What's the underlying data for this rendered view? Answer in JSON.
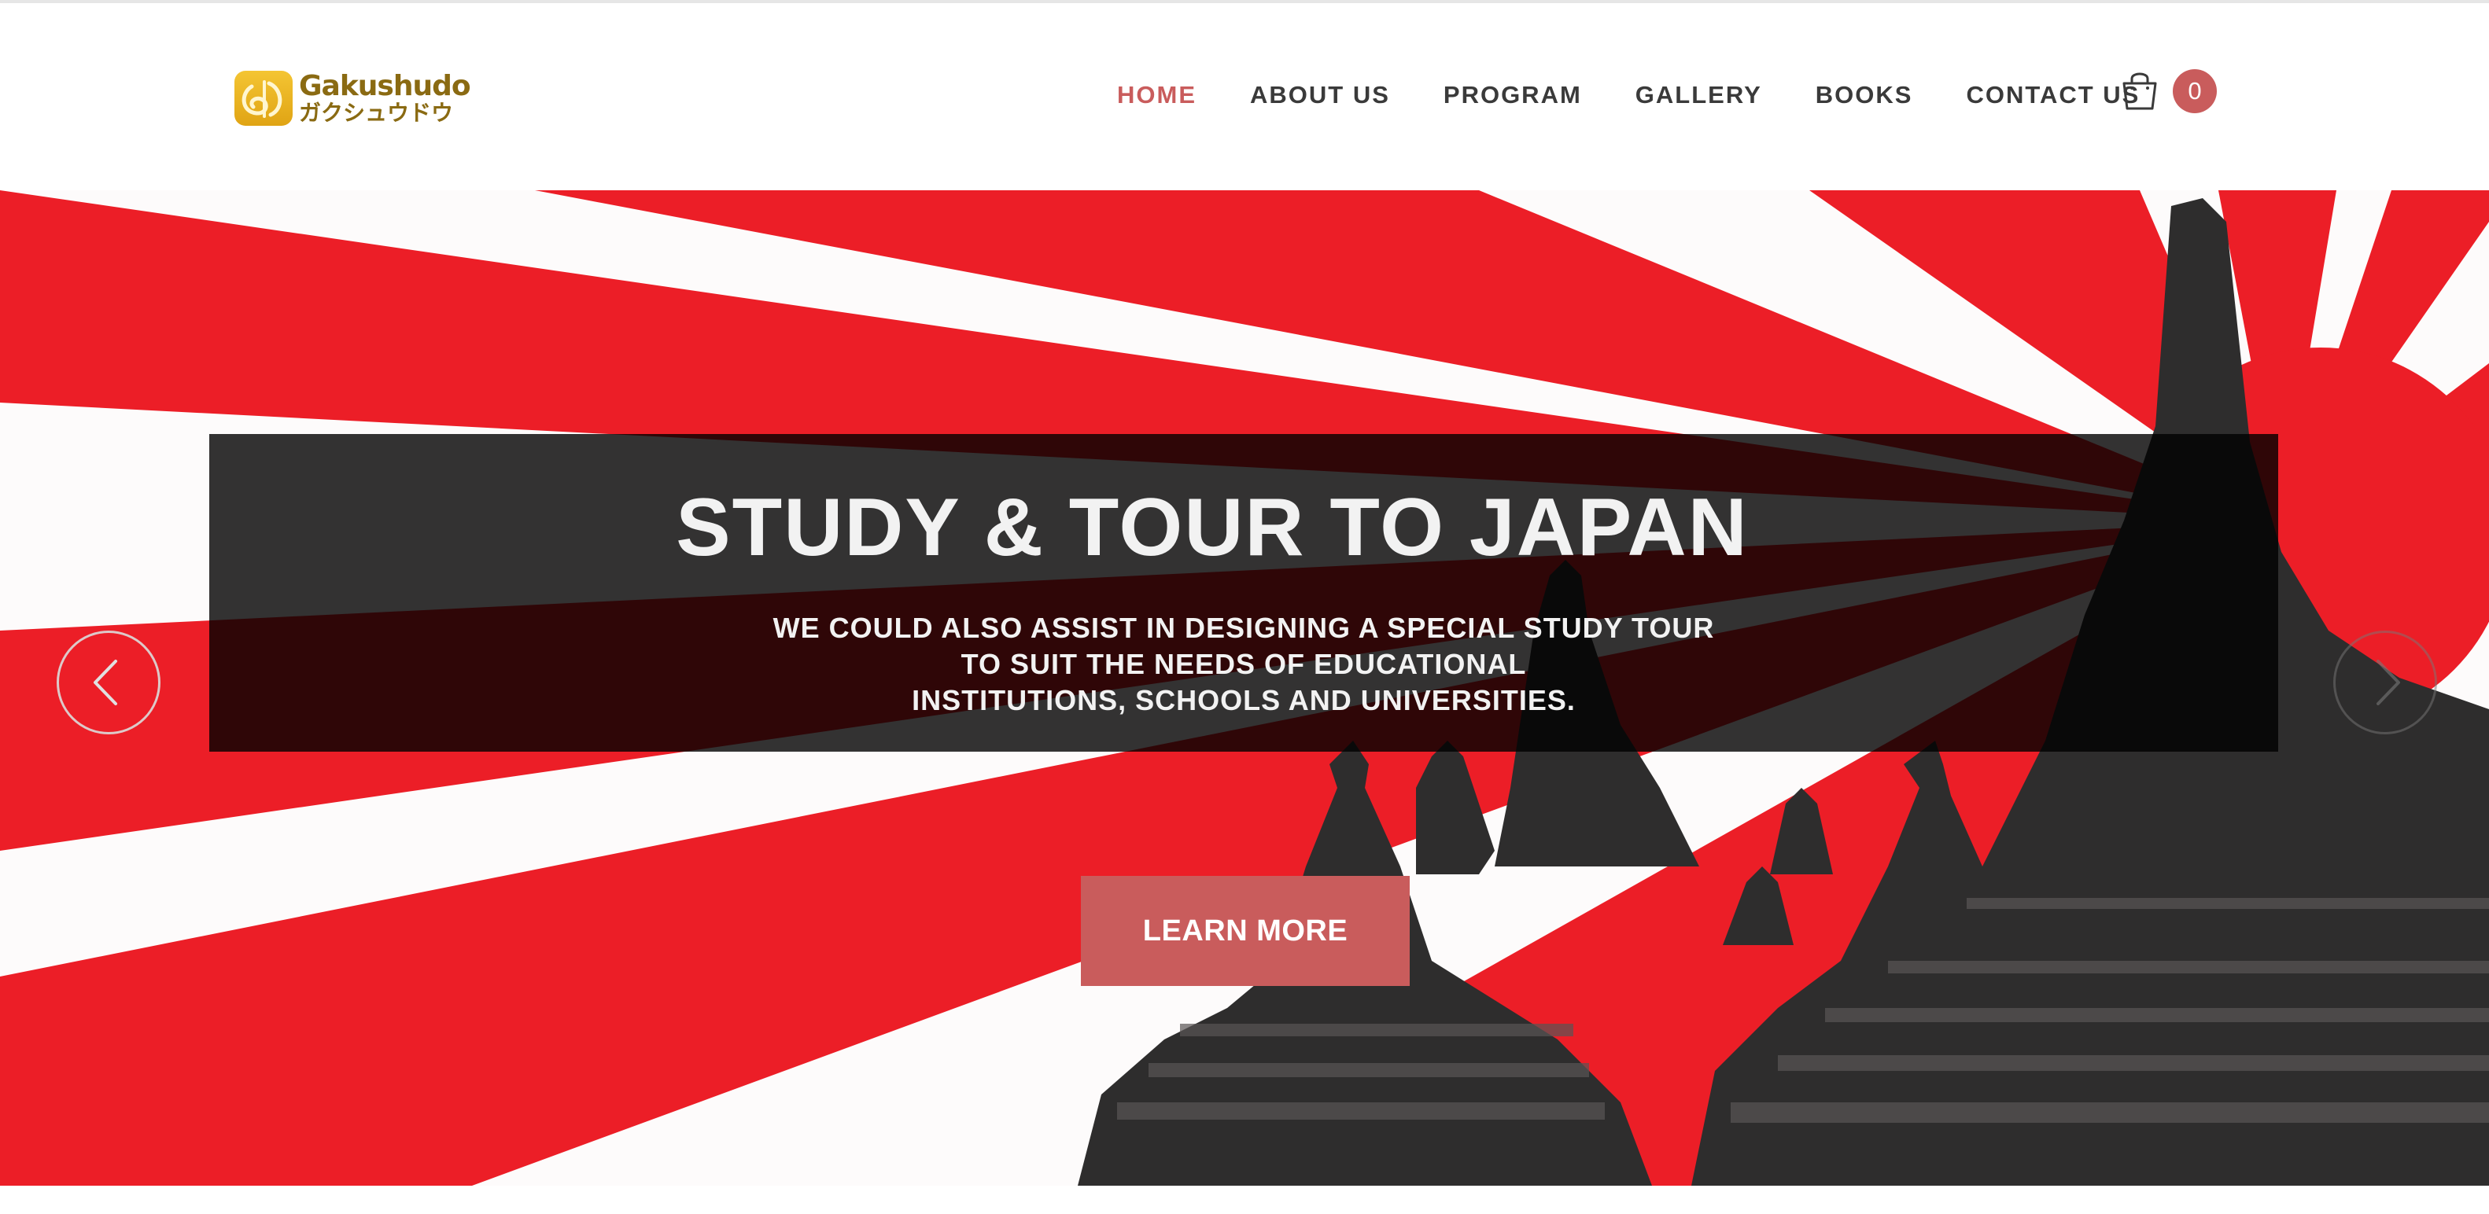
{
  "brand": {
    "name": "Gakushudo",
    "kana": "ガクシュウドウ",
    "accent_color": "#c95c5c",
    "logo_color": "#e8b21f"
  },
  "nav": {
    "items": [
      {
        "label": "HOME",
        "active": true
      },
      {
        "label": "ABOUT US",
        "active": false
      },
      {
        "label": "PROGRAM",
        "active": false
      },
      {
        "label": "GALLERY",
        "active": false
      },
      {
        "label": "BOOKS",
        "active": false
      },
      {
        "label": "CONTACT US",
        "active": false
      }
    ],
    "cart_icon": "shopping-bag-icon",
    "cart_count": "0"
  },
  "hero": {
    "title": "STUDY & TOUR TO JAPAN",
    "subtitle_lines": [
      "WE COULD ALSO ASSIST IN DESIGNING A SPECIAL STUDY TOUR",
      "TO SUIT THE NEEDS OF EDUCATIONAL",
      "INSTITUTIONS, SCHOOLS AND UNIVERSITIES."
    ],
    "cta_label": "LEARN MORE",
    "prev_icon": "chevron-left-icon",
    "next_icon": "chevron-right-icon",
    "background_colors": {
      "red": "#ec1e27",
      "white": "#fdfbfb",
      "stone": "#2e2d2d"
    }
  }
}
